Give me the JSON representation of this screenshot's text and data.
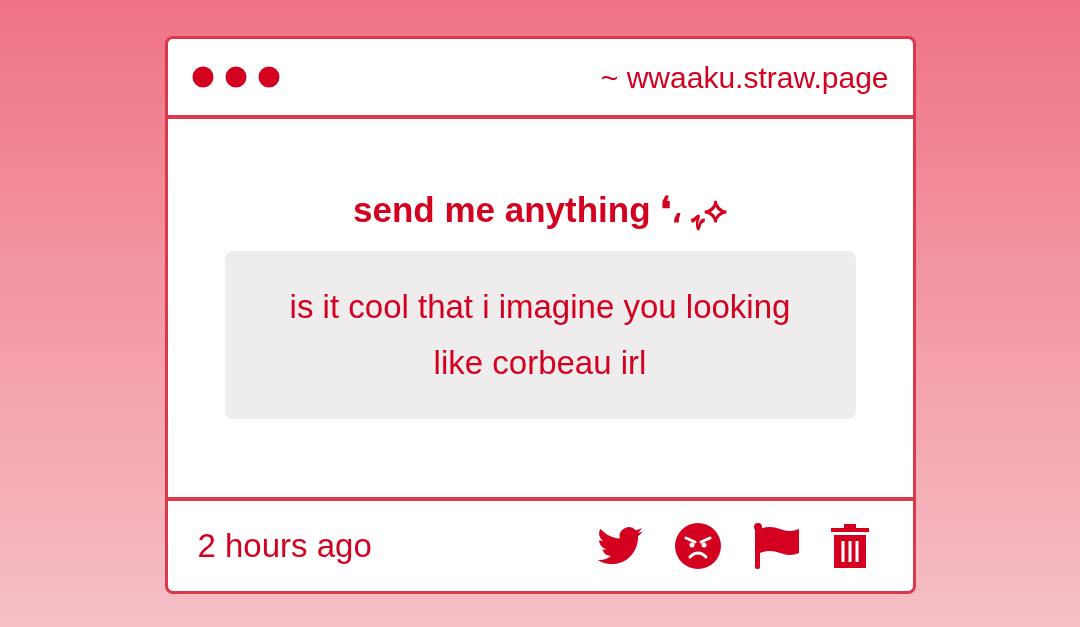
{
  "window": {
    "url": "~ wwaaku.straw.page"
  },
  "prompt": {
    "title": "send me anything ❛، ﮩ⟡"
  },
  "message": {
    "text": "is it cool that i imagine you looking like corbeau irl"
  },
  "footer": {
    "time": "2 hours ago"
  }
}
